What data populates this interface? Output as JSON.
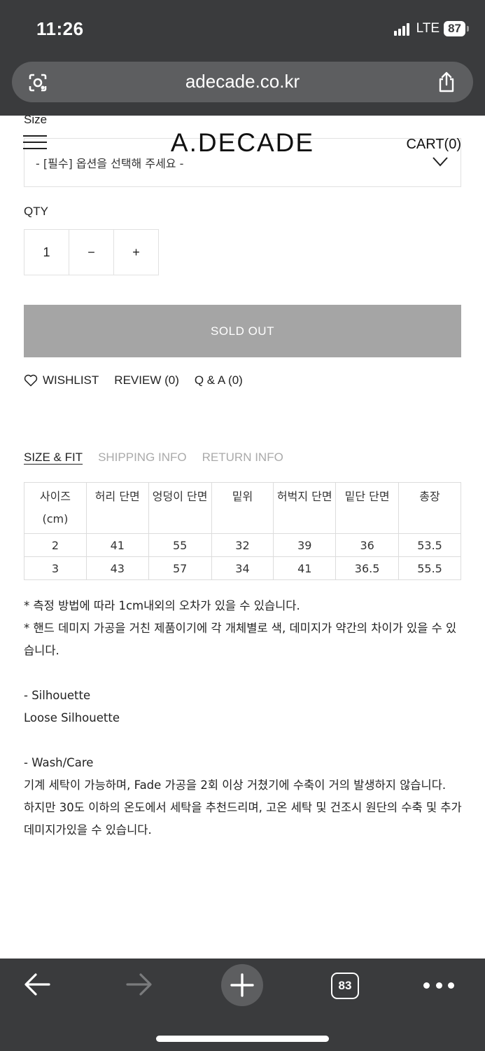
{
  "status": {
    "time": "11:26",
    "network": "LTE",
    "battery": "87"
  },
  "browser": {
    "url": "adecade.co.kr",
    "tab_count": "83"
  },
  "header": {
    "logo": "A.DECADE",
    "cart": "CART(0)"
  },
  "option": {
    "label": "Size",
    "placeholder": "- [필수] 옵션을 선택해 주세요 -"
  },
  "quantity": {
    "label": "QTY",
    "value": "1",
    "minus": "−",
    "plus": "+"
  },
  "buy_button": "SOLD OUT",
  "actions": {
    "wishlist": "WISHLIST",
    "review": "REVIEW (0)",
    "qna": "Q & A (0)"
  },
  "info_tabs": [
    {
      "label": "SIZE & FIT",
      "active": true
    },
    {
      "label": "SHIPPING INFO",
      "active": false
    },
    {
      "label": "RETURN INFO",
      "active": false
    }
  ],
  "size_table": {
    "headers": [
      "사이즈 (cm)",
      "허리 단면",
      "엉덩이 단면",
      "밑위",
      "허벅지 단면",
      "밑단 단면",
      "총장"
    ],
    "rows": [
      [
        "2",
        "41",
        "55",
        "32",
        "39",
        "36",
        "53.5"
      ],
      [
        "3",
        "43",
        "57",
        "34",
        "41",
        "36.5",
        "55.5"
      ]
    ]
  },
  "notes": {
    "note1": "* 측정 방법에 따라 1cm내외의 오차가 있을 수 있습니다.",
    "note2": "* 핸드 데미지 가공을 거친 제품이기에 각 개체별로 색, 데미지가 약간의 차이가 있을 수 있습니다.",
    "silhouette_title": "- Silhouette",
    "silhouette_value": "Loose Silhouette",
    "wash_title": "- Wash/Care",
    "wash_line1": "기계 세탁이 가능하며, Fade 가공을 2회 이상 거쳤기에 수축이 거의 발생하지 않습니다.",
    "wash_line2": "하지만 30도 이하의 온도에서 세탁을 추천드리며, 고온 세탁 및 건조시 원단의 수축 및 추가 데미지가있을 수 있습니다."
  }
}
